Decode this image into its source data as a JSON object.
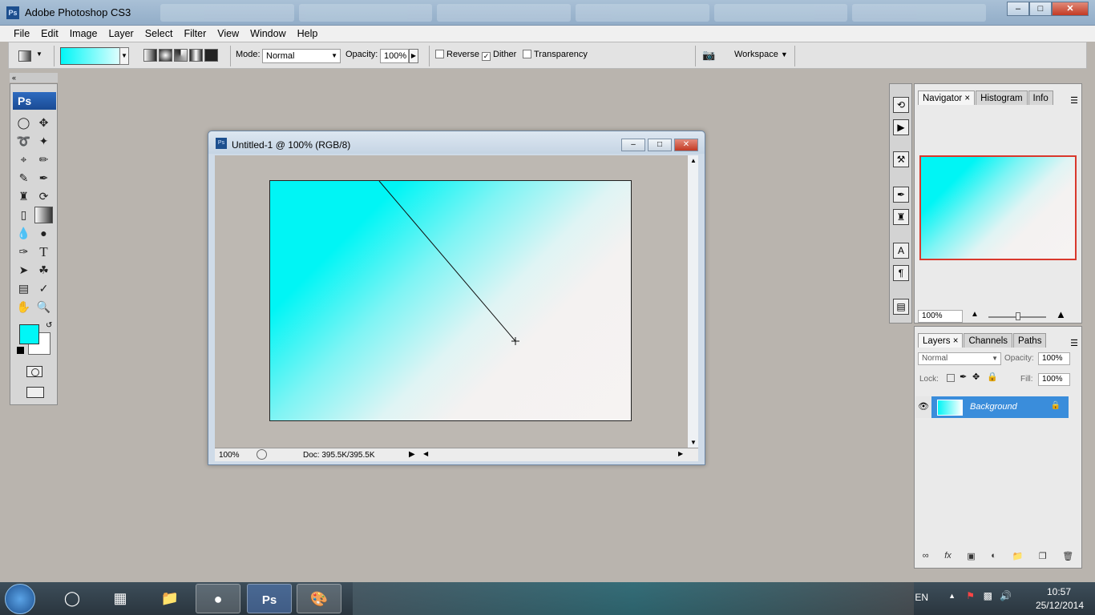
{
  "app": {
    "title": "Adobe Photoshop CS3",
    "icon_label": "Ps",
    "window_buttons": [
      "minimize",
      "maximize",
      "close"
    ]
  },
  "menu": [
    "File",
    "Edit",
    "Image",
    "Layer",
    "Select",
    "Filter",
    "View",
    "Window",
    "Help"
  ],
  "options": {
    "mode_label": "Mode:",
    "mode_value": "Normal",
    "opacity_label": "Opacity:",
    "opacity_value": "100%",
    "reverse_label": "Reverse",
    "reverse_checked": false,
    "dither_label": "Dither",
    "dither_checked": true,
    "transparency_label": "Transparency",
    "transparency_checked": false,
    "workspace_label": "Workspace"
  },
  "toolbox": {
    "logo": "Ps",
    "foreground_color": "#00f7f7",
    "background_color": "#ffffff",
    "tools": [
      "marquee-tool-icon",
      "move-tool-icon",
      "lasso-tool-icon",
      "magic-wand-tool-icon",
      "crop-tool-icon",
      "slice-tool-icon",
      "healing-brush-tool-icon",
      "brush-tool-icon",
      "clone-stamp-tool-icon",
      "history-brush-tool-icon",
      "eraser-tool-icon",
      "gradient-tool-icon",
      "blur-tool-icon",
      "dodge-tool-icon",
      "pen-tool-icon",
      "type-tool-icon",
      "path-selection-tool-icon",
      "custom-shape-tool-icon",
      "notes-tool-icon",
      "eyedropper-tool-icon",
      "hand-tool-icon",
      "zoom-tool-icon"
    ]
  },
  "document": {
    "title": "Untitled-1 @ 100% (RGB/8)",
    "icon_label": "Ps",
    "zoom": "100%",
    "doc_info": "Doc: 395.5K/395.5K",
    "gradient_start": "#00f5f5",
    "gradient_end": "#f6f3f2"
  },
  "navigator": {
    "tabs": [
      "Navigator",
      "Histogram",
      "Info"
    ],
    "zoom": "100%"
  },
  "layers": {
    "tabs": [
      "Layers",
      "Channels",
      "Paths"
    ],
    "blend_mode": "Normal",
    "opacity_label": "Opacity:",
    "opacity_value": "100%",
    "lock_label": "Lock:",
    "fill_label": "Fill:",
    "fill_value": "100%",
    "items": [
      {
        "name": "Background",
        "selected": true,
        "locked": true
      }
    ]
  },
  "taskbar": {
    "language": "EN",
    "time": "10:57",
    "date": "25/12/2014"
  }
}
